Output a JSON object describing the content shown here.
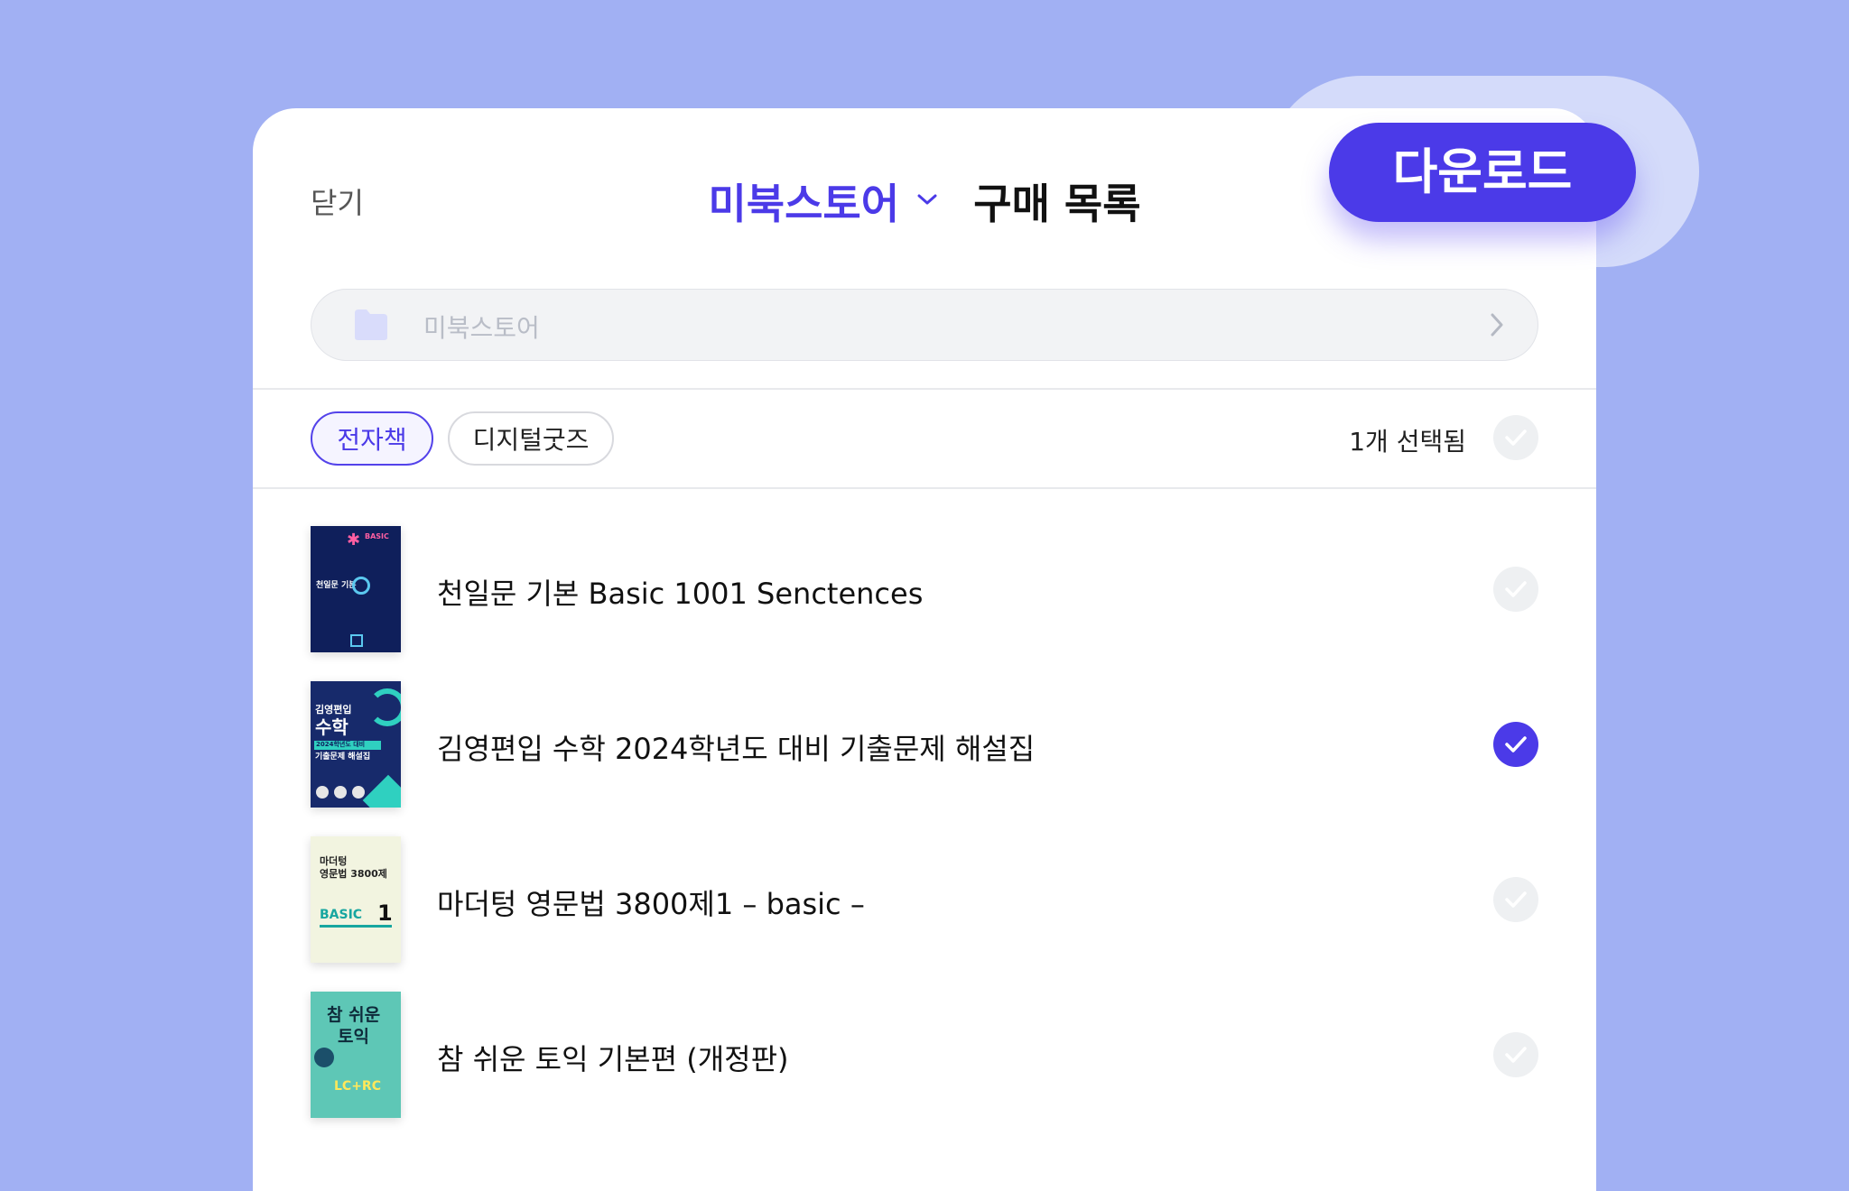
{
  "header": {
    "close_label": "닫기",
    "store_name": "미북스토어",
    "title": "구매 목록"
  },
  "download_button": {
    "label": "다운로드"
  },
  "path_bar": {
    "text": "미북스토어"
  },
  "tabs": [
    {
      "label": "전자책",
      "active": true
    },
    {
      "label": "디지털굿즈",
      "active": false
    }
  ],
  "selection": {
    "count_text": "1개 선택됨"
  },
  "items": [
    {
      "title": "천일문 기본 Basic 1001 Senctences",
      "selected": false,
      "cover": {
        "top": "BASIC",
        "mid": "천일문 기본"
      }
    },
    {
      "title": "김영편입 수학 2024학년도 대비 기출문제 해설집",
      "selected": true,
      "cover": {
        "line1": "김영편입",
        "line2": "수학",
        "line3": "2024학년도 대비",
        "line4": "기출문제 해설집"
      }
    },
    {
      "title": "마더텅 영문법 3800제1 – basic –",
      "selected": false,
      "cover": {
        "line1": "마더텅",
        "line2": "영문법 3800제",
        "line3": "BASIC",
        "num": "1"
      }
    },
    {
      "title": "참 쉬운 토익 기본편 (개정판)",
      "selected": false,
      "cover": {
        "line1": "참 쉬운",
        "line2": "토익",
        "line3": "LC+RC"
      }
    }
  ],
  "colors": {
    "accent": "#4b3ae8",
    "background": "#a1b0f3"
  }
}
